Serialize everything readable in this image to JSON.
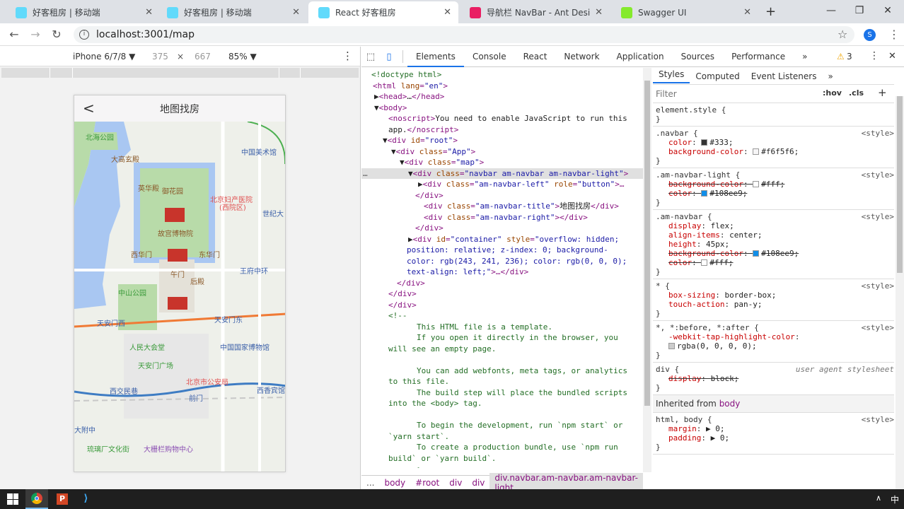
{
  "browser": {
    "tabs": [
      {
        "title": "好客租房 | 移动端",
        "fav": "#61dafb",
        "active": false
      },
      {
        "title": "好客租房 | 移动端",
        "fav": "#61dafb",
        "active": false
      },
      {
        "title": "React 好客租房",
        "fav": "#61dafb",
        "active": true
      },
      {
        "title": "导航栏 NavBar - Ant Design",
        "fav": "#e91e63",
        "active": false
      },
      {
        "title": "Swagger UI",
        "fav": "#85ea2d",
        "active": false
      }
    ],
    "new_tab": "+",
    "url": "localhost:3001/map",
    "profile": "S"
  },
  "device_toolbar": {
    "device": "iPhone 6/7/8 ▼",
    "width": "375",
    "times": "×",
    "height": "667",
    "zoom": "85% ▼"
  },
  "phone": {
    "nav_title": "地图找房",
    "back": "<",
    "map_labels": [
      {
        "t": "北海公园",
        "c": "#3a9a3a"
      },
      {
        "t": "大高玄殿",
        "c": "#8b5a2b"
      },
      {
        "t": "中国美术馆",
        "c": "#3a5fa8"
      },
      {
        "t": "英华殿",
        "c": "#8b5a2b"
      },
      {
        "t": "御花园",
        "c": "#8b5a2b"
      },
      {
        "t": "北京妇产医院",
        "c": "#e05050"
      },
      {
        "t": "(西院区)",
        "c": "#e05050"
      },
      {
        "t": "世纪大",
        "c": "#3a5fa8"
      },
      {
        "t": "故宫博物院",
        "c": "#8b5a2b"
      },
      {
        "t": "西华门",
        "c": "#8b5a2b"
      },
      {
        "t": "东华门",
        "c": "#8b5a2b"
      },
      {
        "t": "王府中环",
        "c": "#3a5fa8"
      },
      {
        "t": "午门",
        "c": "#8b5a2b"
      },
      {
        "t": "后殿",
        "c": "#8b5a2b"
      },
      {
        "t": "中山公园",
        "c": "#3a9a3a"
      },
      {
        "t": "天安门西",
        "c": "#3a5fa8"
      },
      {
        "t": "天安门东",
        "c": "#3a5fa8"
      },
      {
        "t": "人民大会堂",
        "c": "#3a9a3a"
      },
      {
        "t": "中国国家博物馆",
        "c": "#3a5fa8"
      },
      {
        "t": "天安门广场",
        "c": "#3a9a3a"
      },
      {
        "t": "北京市公安局",
        "c": "#e05050"
      },
      {
        "t": "西交民巷",
        "c": "#3a5fa8"
      },
      {
        "t": "前门",
        "c": "#3a5fa8"
      },
      {
        "t": "西香宾馆",
        "c": "#3a5fa8"
      },
      {
        "t": "大附中",
        "c": "#3a5fa8"
      },
      {
        "t": "琉璃厂文化街",
        "c": "#3a9a3a"
      },
      {
        "t": "大栅栏购物中心",
        "c": "#8b4fb3"
      }
    ]
  },
  "devtools": {
    "tabs": [
      "Elements",
      "Console",
      "React",
      "Network",
      "Application",
      "Sources",
      "Performance",
      "»"
    ],
    "warnings": "3",
    "elements": [
      [
        {
          "c": "cm",
          "t": "<!doctype html>"
        }
      ],
      [
        {
          "c": "tg",
          "t": "<html "
        },
        {
          "c": "an",
          "t": "lang"
        },
        {
          "c": "tg",
          "t": "="
        },
        {
          "c": "av",
          "t": "\"en\""
        },
        {
          "c": "tg",
          "t": ">"
        }
      ],
      [
        {
          "c": "tx",
          "t": "▶"
        },
        {
          "c": "tg",
          "t": "<head>"
        },
        {
          "c": "tx",
          "t": "…"
        },
        {
          "c": "tg",
          "t": "</head>"
        }
      ],
      [
        {
          "c": "tx",
          "t": "▼"
        },
        {
          "c": "tg",
          "t": "<body>"
        }
      ],
      [
        {
          "c": "tg",
          "t": "<noscript>"
        },
        {
          "c": "tx",
          "t": "You need to enable JavaScript to run this"
        }
      ],
      [
        {
          "c": "tx",
          "t": "app."
        },
        {
          "c": "tg",
          "t": "</noscript>"
        }
      ],
      [
        {
          "c": "tx",
          "t": "▼"
        },
        {
          "c": "tg",
          "t": "<div "
        },
        {
          "c": "an",
          "t": "id"
        },
        {
          "c": "tg",
          "t": "="
        },
        {
          "c": "av",
          "t": "\"root\""
        },
        {
          "c": "tg",
          "t": ">"
        }
      ],
      [
        {
          "c": "tx",
          "t": "▼"
        },
        {
          "c": "tg",
          "t": "<div "
        },
        {
          "c": "an",
          "t": "class"
        },
        {
          "c": "tg",
          "t": "="
        },
        {
          "c": "av",
          "t": "\"App\""
        },
        {
          "c": "tg",
          "t": ">"
        }
      ],
      [
        {
          "c": "tx",
          "t": "▼"
        },
        {
          "c": "tg",
          "t": "<div "
        },
        {
          "c": "an",
          "t": "class"
        },
        {
          "c": "tg",
          "t": "="
        },
        {
          "c": "av",
          "t": "\"map\""
        },
        {
          "c": "tg",
          "t": ">"
        }
      ],
      [
        {
          "c": "tx",
          "t": "▼"
        },
        {
          "c": "tg",
          "t": "<div "
        },
        {
          "c": "an",
          "t": "class"
        },
        {
          "c": "tg",
          "t": "="
        },
        {
          "c": "av",
          "t": "\"navbar am-navbar am-navbar-light\""
        },
        {
          "c": "tg",
          "t": ">"
        }
      ],
      [
        {
          "c": "tx",
          "t": "▶"
        },
        {
          "c": "tg",
          "t": "<div "
        },
        {
          "c": "an",
          "t": "class"
        },
        {
          "c": "tg",
          "t": "="
        },
        {
          "c": "av",
          "t": "\"am-navbar-left\""
        },
        {
          "c": "tg",
          "t": " "
        },
        {
          "c": "an",
          "t": "role"
        },
        {
          "c": "tg",
          "t": "="
        },
        {
          "c": "av",
          "t": "\"button\""
        },
        {
          "c": "tg",
          "t": ">…"
        }
      ],
      [
        {
          "c": "tg",
          "t": "</div>"
        }
      ],
      [
        {
          "c": "tg",
          "t": "<div "
        },
        {
          "c": "an",
          "t": "class"
        },
        {
          "c": "tg",
          "t": "="
        },
        {
          "c": "av",
          "t": "\"am-navbar-title\""
        },
        {
          "c": "tg",
          "t": ">"
        },
        {
          "c": "tx",
          "t": "地图找房"
        },
        {
          "c": "tg",
          "t": "</div>"
        }
      ],
      [
        {
          "c": "tg",
          "t": "<div "
        },
        {
          "c": "an",
          "t": "class"
        },
        {
          "c": "tg",
          "t": "="
        },
        {
          "c": "av",
          "t": "\"am-navbar-right\""
        },
        {
          "c": "tg",
          "t": "></div>"
        }
      ],
      [
        {
          "c": "tg",
          "t": "</div>"
        }
      ],
      [
        {
          "c": "tx",
          "t": "▶"
        },
        {
          "c": "tg",
          "t": "<div "
        },
        {
          "c": "an",
          "t": "id"
        },
        {
          "c": "tg",
          "t": "="
        },
        {
          "c": "av",
          "t": "\"container\""
        },
        {
          "c": "tg",
          "t": " "
        },
        {
          "c": "an",
          "t": "style"
        },
        {
          "c": "tg",
          "t": "="
        },
        {
          "c": "av",
          "t": "\"overflow: hidden;"
        }
      ],
      [
        {
          "c": "av",
          "t": "position: relative; z-index: 0; background-"
        }
      ],
      [
        {
          "c": "av",
          "t": "color: rgb(243, 241, 236); color: rgb(0, 0, 0);"
        }
      ],
      [
        {
          "c": "av",
          "t": "text-align: left;\""
        },
        {
          "c": "tg",
          "t": ">…</div>"
        }
      ],
      [
        {
          "c": "tg",
          "t": "</div>"
        }
      ],
      [
        {
          "c": "tg",
          "t": "</div>"
        }
      ],
      [
        {
          "c": "tg",
          "t": "</div>"
        }
      ],
      [
        {
          "c": "cm",
          "t": "<!--"
        }
      ],
      [
        {
          "c": "cm",
          "t": "This HTML file is a template."
        }
      ],
      [
        {
          "c": "cm",
          "t": "If you open it directly in the browser, you"
        }
      ],
      [
        {
          "c": "cm",
          "t": "will see an empty page."
        }
      ],
      [
        {
          "c": "cm",
          "t": ""
        }
      ],
      [
        {
          "c": "cm",
          "t": "You can add webfonts, meta tags, or analytics"
        }
      ],
      [
        {
          "c": "cm",
          "t": "to this file."
        }
      ],
      [
        {
          "c": "cm",
          "t": "The build step will place the bundled scripts"
        }
      ],
      [
        {
          "c": "cm",
          "t": "into the <body> tag."
        }
      ],
      [
        {
          "c": "cm",
          "t": ""
        }
      ],
      [
        {
          "c": "cm",
          "t": "To begin the development, run `npm start` or"
        }
      ],
      [
        {
          "c": "cm",
          "t": "`yarn start`."
        }
      ],
      [
        {
          "c": "cm",
          "t": "To create a production bundle, use `npm run"
        }
      ],
      [
        {
          "c": "cm",
          "t": "build` or `yarn build`."
        }
      ],
      [
        {
          "c": "cm",
          "t": "-->"
        }
      ]
    ],
    "breadcrumb": [
      "...",
      "body",
      "#root",
      "div",
      "div",
      "div.navbar.am-navbar.am-navbar-light"
    ],
    "styles_tabs": [
      "Styles",
      "Computed",
      "Event Listeners",
      "»"
    ],
    "filter_placeholder": "Filter",
    "hov": ":hov",
    "cls": ".cls",
    "plus": "+",
    "rules": [
      {
        "sel": "element.style {",
        "src": "",
        "props": []
      },
      {
        "sel": ".navbar {",
        "src": "<style>",
        "props": [
          {
            "n": "color",
            "v": "#333;",
            "sw": "#333333",
            "s": false
          },
          {
            "n": "background-color",
            "v": "#f6f5f6;",
            "sw": "#f6f5f6",
            "s": false
          }
        ]
      },
      {
        "sel": ".am-navbar-light {",
        "src": "<style>",
        "props": [
          {
            "n": "background-color",
            "v": "#fff;",
            "sw": "#ffffff",
            "s": true
          },
          {
            "n": "color",
            "v": "#108ee9;",
            "sw": "#108ee9",
            "s": true
          }
        ]
      },
      {
        "sel": ".am-navbar {",
        "src": "<style>",
        "props": [
          {
            "n": "display",
            "v": "flex;",
            "sw": "",
            "s": false
          },
          {
            "n": "align-items",
            "v": "center;",
            "sw": "",
            "s": false
          },
          {
            "n": "height",
            "v": "45px;",
            "sw": "",
            "s": false
          },
          {
            "n": "background-color",
            "v": "#108ee9;",
            "sw": "#108ee9",
            "s": true
          },
          {
            "n": "color",
            "v": "#fff;",
            "sw": "#ffffff",
            "s": true
          }
        ]
      },
      {
        "sel": "* {",
        "src": "<style>",
        "props": [
          {
            "n": "box-sizing",
            "v": "border-box;",
            "sw": "",
            "s": false
          },
          {
            "n": "touch-action",
            "v": "pan-y;",
            "sw": "",
            "s": false
          }
        ]
      },
      {
        "sel": "*, *:before, *:after {",
        "src": "<style>",
        "props": [
          {
            "n": "-webkit-tap-highlight-color",
            "v": "",
            "sw": "",
            "s": false
          },
          {
            "n": "",
            "v": "rgba(0, 0, 0, 0);",
            "sw": "#cccccc",
            "s": false
          }
        ]
      },
      {
        "sel": "div {",
        "src": "user agent stylesheet",
        "props": [
          {
            "n": "display",
            "v": "block;",
            "sw": "",
            "s": true
          }
        ]
      }
    ],
    "inherited_label": "Inherited from",
    "inherited_from": "body",
    "html_body": {
      "sel": "html, body {",
      "src": "<style>",
      "props": [
        {
          "n": "margin",
          "v": "▶ 0;"
        },
        {
          "n": "padding",
          "v": "▶ 0;"
        }
      ]
    }
  },
  "taskbar": {
    "lang": "中"
  }
}
